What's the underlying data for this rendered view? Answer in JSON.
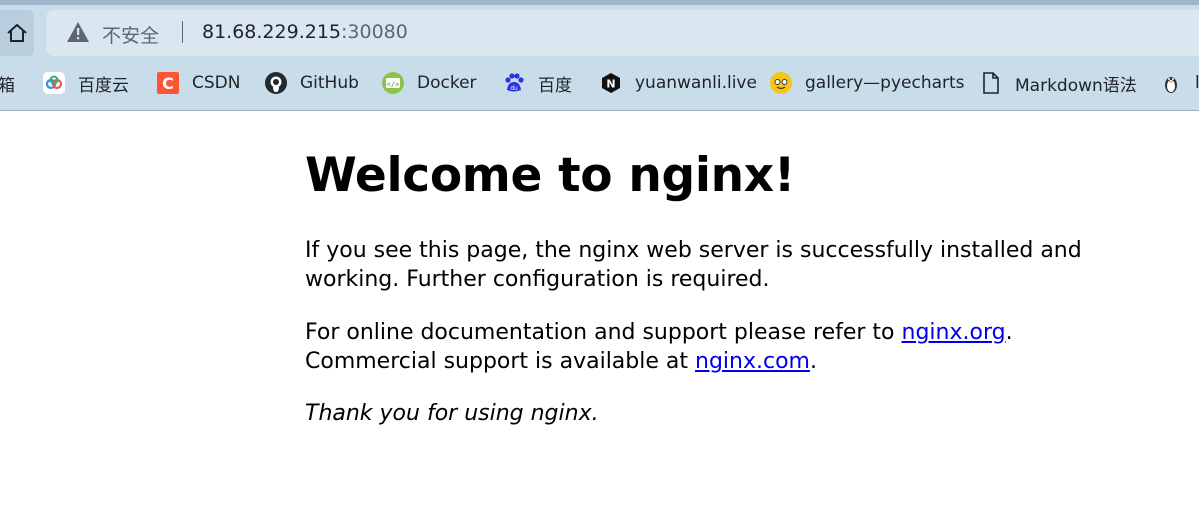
{
  "browser": {
    "insecure_label": "不安全",
    "url_host": "81.68.229.215",
    "url_port": ":30080",
    "bookmarks": [
      {
        "label": "箱",
        "icon": "truncated-bookmark"
      },
      {
        "label": "百度云",
        "icon": "baidu-cloud-icon"
      },
      {
        "label": "CSDN",
        "icon": "csdn-icon"
      },
      {
        "label": "GitHub",
        "icon": "github-icon"
      },
      {
        "label": "Docker",
        "icon": "docker-icon"
      },
      {
        "label": "百度",
        "icon": "baidu-paw-icon"
      },
      {
        "label": "yuanwanli.live",
        "icon": "hexagon-n-icon"
      },
      {
        "label": "gallery—pyecharts",
        "icon": "pyecharts-icon"
      },
      {
        "label": "Markdown语法",
        "icon": "document-icon"
      },
      {
        "label": "l",
        "icon": "linux-penguin-icon"
      }
    ]
  },
  "page": {
    "heading": "Welcome to nginx!",
    "para1": "If you see this page, the nginx web server is successfully installed and working. Further configuration is required.",
    "para2_prefix": "For online documentation and support please refer to ",
    "para2_link": "nginx.org",
    "para2_mid": ".",
    "para2_line2_prefix": "Commercial support is available at ",
    "para2_link2": "nginx.com",
    "para2_end": ".",
    "thanks": "Thank you for using nginx."
  }
}
